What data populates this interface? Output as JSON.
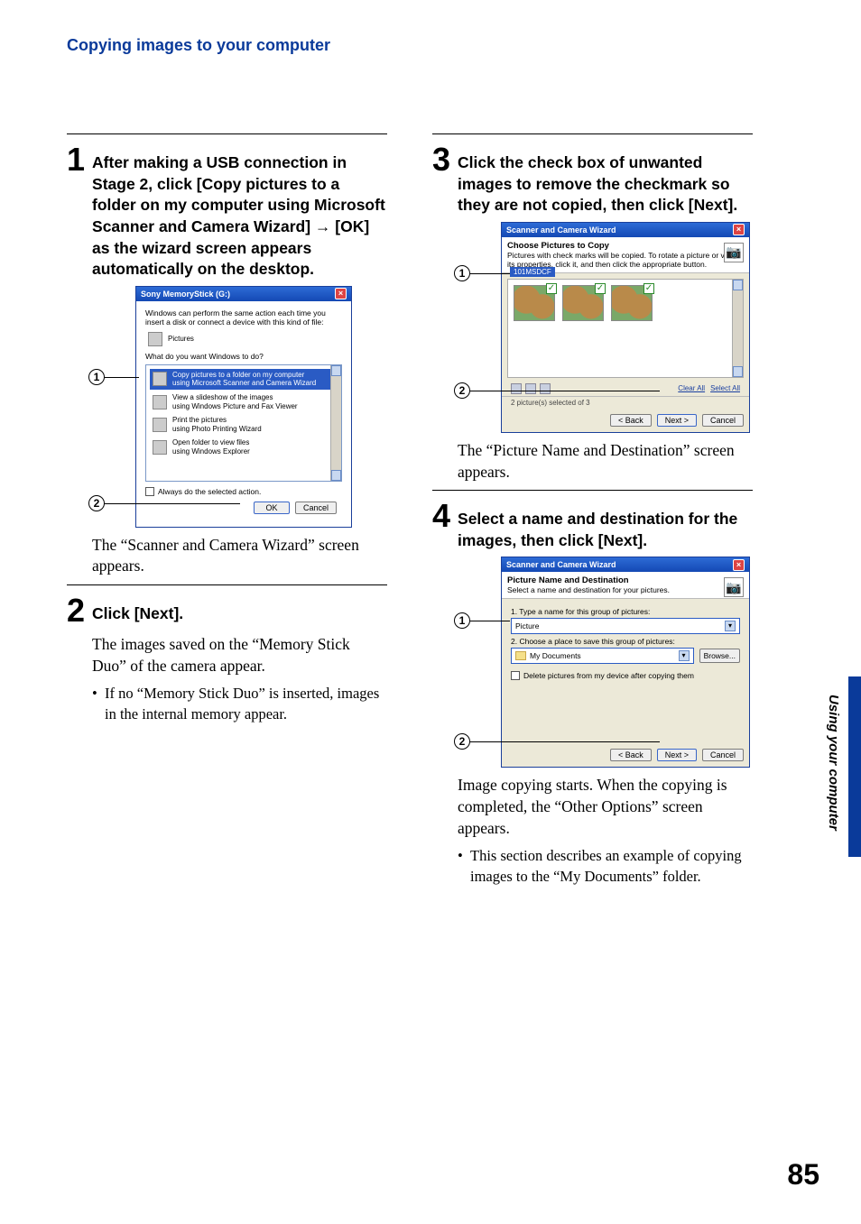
{
  "header": "Copying images to your computer",
  "side_label": "Using your computer",
  "page_number": "85",
  "left": {
    "step1": {
      "num": "1",
      "head": "After making a USB connection in Stage 2, click [Copy pictures to a folder on my computer using Microsoft Scanner and Camera Wizard] → [OK] as the wizard screen appears automatically on the desktop.",
      "dlg": {
        "title": "Sony MemoryStick (G:)",
        "intro": "Windows can perform the same action each time you insert a disk or connect a device with this kind of file:",
        "filetype": "Pictures",
        "prompt": "What do you want Windows to do?",
        "options": [
          "Copy pictures to a folder on my computer\nusing Microsoft Scanner and Camera Wizard",
          "View a slideshow of the images\nusing Windows Picture and Fax Viewer",
          "Print the pictures\nusing Photo Printing Wizard",
          "Open folder to view files\nusing Windows Explorer"
        ],
        "always": "Always do the selected action.",
        "ok": "OK",
        "cancel": "Cancel"
      },
      "after": "The “Scanner and Camera Wizard” screen appears."
    },
    "step2": {
      "num": "2",
      "head": "Click [Next].",
      "body": "The images saved on the “Memory Stick Duo” of the camera appear.",
      "bullet": "If no “Memory Stick Duo” is inserted, images in the internal memory appear."
    }
  },
  "right": {
    "step3": {
      "num": "3",
      "head": "Click the check box of unwanted images to remove the checkmark so they are not copied, then click [Next].",
      "dlg": {
        "title": "Scanner and Camera Wizard",
        "subhead_title": "Choose Pictures to Copy",
        "subhead_text": "Pictures with check marks will be copied. To rotate a picture or view its properties, click it, and then click the appropriate button.",
        "thumb_header": "101MSDCF",
        "links": {
          "clear": "Clear All",
          "select": "Select All"
        },
        "status": "2 picture(s) selected of 3",
        "back": "< Back",
        "next": "Next >",
        "cancel": "Cancel"
      },
      "after": "The “Picture Name and Destination” screen appears."
    },
    "step4": {
      "num": "4",
      "head": "Select a name and destination for the images, then click [Next].",
      "dlg": {
        "title": "Scanner and Camera Wizard",
        "subhead_title": "Picture Name and Destination",
        "subhead_text": "Select a name and destination for your pictures.",
        "label1": "1.   Type a name for this group of pictures:",
        "field1": "Picture",
        "label2": "2.   Choose a place to save this group of pictures:",
        "field2": "My Documents",
        "browse": "Browse...",
        "chk": "Delete pictures from my device after copying them",
        "back": "< Back",
        "next": "Next >",
        "cancel": "Cancel"
      },
      "after": "Image copying starts. When the copying is completed, the “Other Options” screen appears.",
      "bullet": "This section describes an example of copying images to the “My Documents” folder."
    }
  },
  "callouts": {
    "1": "1",
    "2": "2"
  }
}
